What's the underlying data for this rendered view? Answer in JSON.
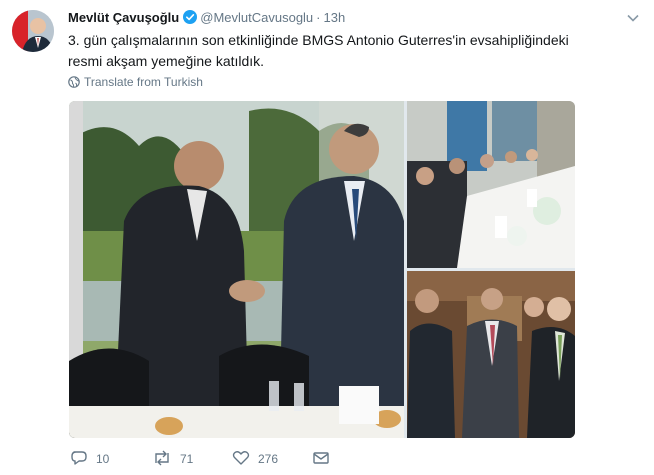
{
  "tweet": {
    "author_name": "Mevlüt Çavuşoğlu",
    "handle": "@MevlutCavusoglu",
    "separator": "·",
    "time": "13h",
    "text_line1": "3. gün çalışmalarının son etkinliğinde BMGS Antonio Guterres'in evsahipliğindeki",
    "text_line2": "resmi akşam yemeğine katıldık.",
    "translate_label": "Translate from Turkish",
    "verified_color": "#1da1f2"
  },
  "actions": {
    "replies": "10",
    "retweets": "71",
    "likes": "276"
  },
  "icons": [
    "verified-icon",
    "chevron-down-icon",
    "globe-icon",
    "reply-icon",
    "retweet-icon",
    "like-icon",
    "direct-message-icon"
  ],
  "colors": {
    "text": "#14171a",
    "muted": "#657786",
    "accent": "#1da1f2"
  }
}
